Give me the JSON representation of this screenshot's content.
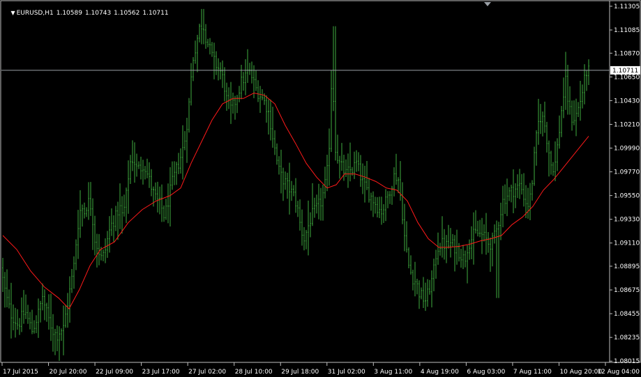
{
  "header": {
    "symbol_tf": "EURUSD,H1",
    "open": "1.10589",
    "high": "1.10743",
    "low": "1.10562",
    "close": "1.10711"
  },
  "current_price": "1.10711",
  "colors": {
    "background": "#000000",
    "bars": "#3fae3f",
    "ma": "#ff1a1a",
    "frame": "#c0c0c0",
    "text": "#ffffff",
    "bid_line": "#9aa0a6"
  },
  "chart_data": {
    "type": "ohlc",
    "symbol": "EURUSD",
    "timeframe": "H1",
    "ylim": [
      1.0801,
      1.1135
    ],
    "y_ticks": [
      "1.11305",
      "1.11085",
      "1.10870",
      "1.10650",
      "1.10430",
      "1.10210",
      "1.09990",
      "1.09770",
      "1.09550",
      "1.09330",
      "1.09110",
      "1.08895",
      "1.08675",
      "1.08455",
      "1.08235",
      "1.08015"
    ],
    "x_ticks": [
      "17 Jul 2015",
      "20 Jul 20:00",
      "22 Jul 09:00",
      "23 Jul 17:00",
      "27 Jul 02:00",
      "28 Jul 10:00",
      "29 Jul 18:00",
      "31 Jul 02:00",
      "3 Aug 11:00",
      "4 Aug 19:00",
      "6 Aug 03:00",
      "7 Aug 11:00",
      "10 Aug 20:00",
      "12 Aug 04:00"
    ],
    "price_path": [
      [
        0,
        1.0888
      ],
      [
        5,
        1.087
      ],
      [
        10,
        1.0855
      ],
      [
        15,
        1.0845
      ],
      [
        20,
        1.084
      ],
      [
        25,
        1.0835
      ],
      [
        30,
        1.0842
      ],
      [
        35,
        1.0848
      ],
      [
        40,
        1.0838
      ],
      [
        45,
        1.083
      ],
      [
        50,
        1.0838
      ],
      [
        55,
        1.0848
      ],
      [
        60,
        1.0862
      ],
      [
        65,
        1.0848
      ],
      [
        70,
        1.0838
      ],
      [
        75,
        1.083
      ],
      [
        80,
        1.0825
      ],
      [
        85,
        1.083
      ],
      [
        90,
        1.0832
      ],
      [
        95,
        1.0852
      ],
      [
        100,
        1.087
      ],
      [
        105,
        1.089
      ],
      [
        110,
        1.0925
      ],
      [
        115,
        1.0945
      ],
      [
        120,
        1.094
      ],
      [
        125,
        1.095
      ],
      [
        130,
        1.0945
      ],
      [
        135,
        1.0915
      ],
      [
        140,
        1.0905
      ],
      [
        145,
        1.0895
      ],
      [
        150,
        1.0905
      ],
      [
        155,
        1.092
      ],
      [
        160,
        1.093
      ],
      [
        165,
        1.0935
      ],
      [
        170,
        1.0945
      ],
      [
        175,
        1.0935
      ],
      [
        180,
        1.0955
      ],
      [
        185,
        1.0985
      ],
      [
        190,
        1.099
      ],
      [
        195,
        1.098
      ],
      [
        200,
        1.098
      ],
      [
        205,
        1.0985
      ],
      [
        210,
        1.0975
      ],
      [
        215,
        1.0965
      ],
      [
        220,
        1.0955
      ],
      [
        225,
        1.095
      ],
      [
        230,
        1.0945
      ],
      [
        235,
        1.0935
      ],
      [
        240,
        1.095
      ],
      [
        245,
        1.0965
      ],
      [
        250,
        1.0975
      ],
      [
        255,
        1.0985
      ],
      [
        260,
        1.0995
      ],
      [
        265,
        1.101
      ],
      [
        270,
        1.104
      ],
      [
        275,
        1.108
      ],
      [
        280,
        1.1095
      ],
      [
        285,
        1.111
      ],
      [
        290,
        1.1115
      ],
      [
        295,
        1.11
      ],
      [
        300,
        1.109
      ],
      [
        305,
        1.108
      ],
      [
        310,
        1.1075
      ],
      [
        315,
        1.107
      ],
      [
        320,
        1.106
      ],
      [
        325,
        1.104
      ],
      [
        330,
        1.1035
      ],
      [
        335,
        1.104
      ],
      [
        340,
        1.105
      ],
      [
        345,
        1.106
      ],
      [
        350,
        1.1065
      ],
      [
        355,
        1.107
      ],
      [
        360,
        1.1065
      ],
      [
        365,
        1.1055
      ],
      [
        370,
        1.105
      ],
      [
        375,
        1.1045
      ],
      [
        380,
        1.104
      ],
      [
        385,
        1.103
      ],
      [
        390,
        1.101
      ],
      [
        395,
        1.099
      ],
      [
        400,
        1.0975
      ],
      [
        405,
        1.097
      ],
      [
        410,
        1.0965
      ],
      [
        415,
        1.096
      ],
      [
        420,
        1.0955
      ],
      [
        425,
        1.0945
      ],
      [
        430,
        1.0925
      ],
      [
        435,
        1.0915
      ],
      [
        440,
        1.0925
      ],
      [
        445,
        1.0935
      ],
      [
        450,
        1.094
      ],
      [
        455,
        1.0945
      ],
      [
        460,
        1.095
      ],
      [
        465,
        1.0965
      ],
      [
        470,
        1.0985
      ],
      [
        475,
        1.1075
      ],
      [
        480,
        1.1
      ],
      [
        485,
        1.0985
      ],
      [
        490,
        1.098
      ],
      [
        495,
        1.0975
      ],
      [
        500,
        1.0978
      ],
      [
        505,
        1.098
      ],
      [
        510,
        1.0985
      ],
      [
        515,
        1.0975
      ],
      [
        520,
        1.0965
      ],
      [
        525,
        1.096
      ],
      [
        530,
        1.0955
      ],
      [
        535,
        1.095
      ],
      [
        540,
        1.0945
      ],
      [
        545,
        1.094
      ],
      [
        550,
        1.0945
      ],
      [
        555,
        1.0955
      ],
      [
        560,
        1.0965
      ],
      [
        565,
        1.0975
      ],
      [
        570,
        1.097
      ],
      [
        575,
        1.0945
      ],
      [
        580,
        1.091
      ],
      [
        585,
        1.089
      ],
      [
        590,
        1.088
      ],
      [
        595,
        1.0875
      ],
      [
        600,
        1.0865
      ],
      [
        605,
        1.086
      ],
      [
        610,
        1.0858
      ],
      [
        615,
        1.087
      ],
      [
        620,
        1.088
      ],
      [
        625,
        1.0905
      ],
      [
        630,
        1.091
      ],
      [
        635,
        1.091
      ],
      [
        640,
        1.0908
      ],
      [
        645,
        1.091
      ],
      [
        650,
        1.0908
      ],
      [
        655,
        1.0905
      ],
      [
        660,
        1.09
      ],
      [
        665,
        1.0895
      ],
      [
        670,
        1.091
      ],
      [
        675,
        1.0915
      ],
      [
        680,
        1.092
      ],
      [
        685,
        1.092
      ],
      [
        690,
        1.0918
      ],
      [
        695,
        1.0915
      ],
      [
        700,
        1.091
      ],
      [
        705,
        1.0912
      ],
      [
        710,
        1.092
      ],
      [
        715,
        1.0935
      ],
      [
        720,
        1.095
      ],
      [
        725,
        1.0955
      ],
      [
        730,
        1.0958
      ],
      [
        735,
        1.096
      ],
      [
        740,
        1.0962
      ],
      [
        745,
        1.0965
      ],
      [
        750,
        1.0955
      ],
      [
        755,
        1.0945
      ],
      [
        760,
        1.0955
      ],
      [
        765,
        1.099
      ],
      [
        770,
        1.102
      ],
      [
        775,
        1.103
      ],
      [
        780,
        1.102
      ],
      [
        785,
        1.1
      ],
      [
        790,
        1.098
      ],
      [
        795,
        1.0985
      ],
      [
        800,
        1.101
      ],
      [
        805,
        1.104
      ],
      [
        810,
        1.106
      ],
      [
        815,
        1.1035
      ],
      [
        820,
        1.1025
      ],
      [
        825,
        1.103
      ],
      [
        830,
        1.104
      ],
      [
        835,
        1.1055
      ],
      [
        840,
        1.107
      ]
    ],
    "ma_path": [
      [
        0,
        1.0918
      ],
      [
        20,
        1.0905
      ],
      [
        40,
        1.0885
      ],
      [
        60,
        1.087
      ],
      [
        80,
        1.086
      ],
      [
        95,
        1.085
      ],
      [
        110,
        1.0868
      ],
      [
        125,
        1.089
      ],
      [
        140,
        1.0905
      ],
      [
        160,
        1.0912
      ],
      [
        180,
        1.093
      ],
      [
        200,
        1.0942
      ],
      [
        220,
        1.095
      ],
      [
        240,
        1.0955
      ],
      [
        255,
        1.0962
      ],
      [
        270,
        1.0985
      ],
      [
        285,
        1.1005
      ],
      [
        300,
        1.1025
      ],
      [
        315,
        1.104
      ],
      [
        330,
        1.1045
      ],
      [
        345,
        1.1045
      ],
      [
        360,
        1.105
      ],
      [
        375,
        1.1048
      ],
      [
        390,
        1.104
      ],
      [
        405,
        1.102
      ],
      [
        420,
        1.1003
      ],
      [
        435,
        1.0985
      ],
      [
        450,
        1.0972
      ],
      [
        465,
        1.0962
      ],
      [
        478,
        1.0965
      ],
      [
        490,
        1.0975
      ],
      [
        505,
        1.0975
      ],
      [
        520,
        1.0972
      ],
      [
        535,
        1.0968
      ],
      [
        550,
        1.0962
      ],
      [
        565,
        1.096
      ],
      [
        580,
        1.095
      ],
      [
        595,
        1.093
      ],
      [
        610,
        1.0915
      ],
      [
        625,
        1.0907
      ],
      [
        640,
        1.0907
      ],
      [
        655,
        1.0908
      ],
      [
        670,
        1.091
      ],
      [
        685,
        1.0913
      ],
      [
        700,
        1.0915
      ],
      [
        715,
        1.0918
      ],
      [
        730,
        1.0928
      ],
      [
        745,
        1.0935
      ],
      [
        760,
        1.0945
      ],
      [
        775,
        1.096
      ],
      [
        790,
        1.097
      ],
      [
        800,
        1.0978
      ],
      [
        815,
        1.099
      ],
      [
        830,
        1.1002
      ],
      [
        840,
        1.101
      ]
    ]
  }
}
